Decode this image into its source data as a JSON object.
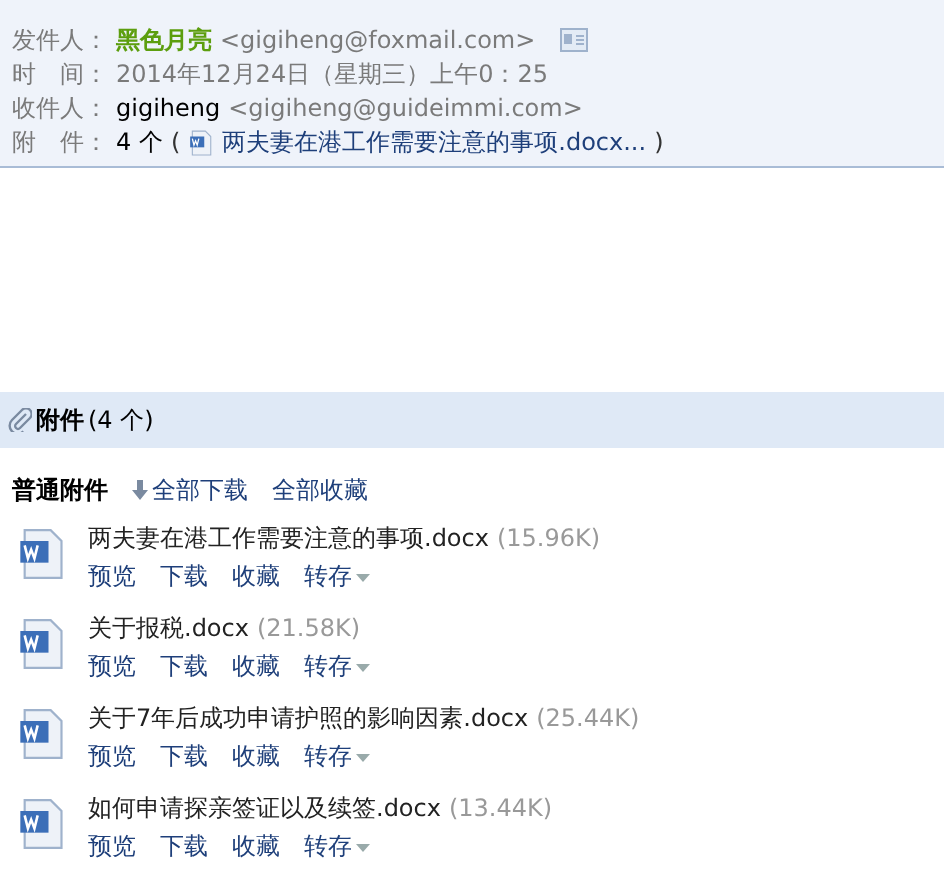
{
  "header": {
    "fields": [
      {
        "kind": "sender",
        "label": "发件人：",
        "name": "黑色月亮",
        "address": "<gigiheng@foxmail.com>"
      },
      {
        "kind": "time",
        "label": "时　间：",
        "value": "2014年12月24日（星期三）上午0：25"
      },
      {
        "kind": "recipient",
        "label": "收件人：",
        "name": "gigiheng",
        "address": "<gigiheng@guideimmi.com>"
      },
      {
        "kind": "attachment",
        "label": "附　件：",
        "count": "4 个",
        "open": "(",
        "file": "两夫妻在港工作需要注意的事项.docx...",
        "close": ")"
      }
    ]
  },
  "attachments": {
    "title": "附件",
    "count": "(4 个)",
    "section": "普通附件",
    "download_all": "全部下载",
    "save_all": "全部收藏",
    "files": [
      {
        "name": "两夫妻在港工作需要注意的事项.docx",
        "size": "(15.96K)",
        "actions": [
          "预览",
          "下载",
          "收藏"
        ],
        "save_to": "转存"
      },
      {
        "name": "关于报税.docx",
        "size": "(21.58K)",
        "actions": [
          "预览",
          "下载",
          "收藏"
        ],
        "save_to": "转存"
      },
      {
        "name": "关于7年后成功申请护照的影响因素.docx",
        "size": "(25.44K)",
        "actions": [
          "预览",
          "下载",
          "收藏"
        ],
        "save_to": "转存"
      },
      {
        "name": "如何申请探亲签证以及续签.docx",
        "size": "(13.44K)",
        "actions": [
          "预览",
          "下载",
          "收藏"
        ],
        "save_to": "转存"
      }
    ]
  }
}
